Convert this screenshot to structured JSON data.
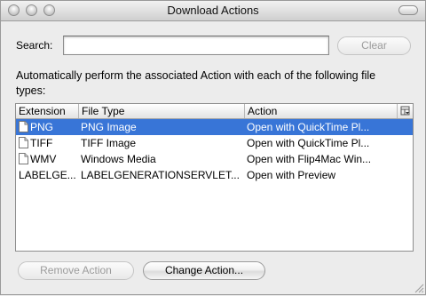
{
  "window": {
    "title": "Download Actions"
  },
  "search": {
    "label": "Search:",
    "value": "",
    "placeholder": "",
    "clear_label": "Clear"
  },
  "description": "Automatically perform the associated Action with each of the following file types:",
  "table": {
    "columns": [
      "Extension",
      "File Type",
      "Action"
    ],
    "rows": [
      {
        "extension": "PNG",
        "file_type": "PNG Image",
        "action": "Open with QuickTime Pl...",
        "icon": "document-icon",
        "selected": true
      },
      {
        "extension": "TIFF",
        "file_type": "TIFF Image",
        "action": "Open with QuickTime Pl...",
        "icon": "document-icon",
        "selected": false
      },
      {
        "extension": "WMV",
        "file_type": "Windows Media",
        "action": "Open with Flip4Mac Win...",
        "icon": "document-icon",
        "selected": false
      },
      {
        "extension": "LABELGE...",
        "file_type": "LABELGENERATIONSERVLET...",
        "action": "Open with Preview",
        "icon": "",
        "selected": false
      }
    ]
  },
  "buttons": {
    "remove_label": "Remove Action",
    "change_label": "Change Action..."
  },
  "colors": {
    "selection": "#3875d7",
    "alt_row": "#edf3fe",
    "window_bg": "#ececec"
  }
}
